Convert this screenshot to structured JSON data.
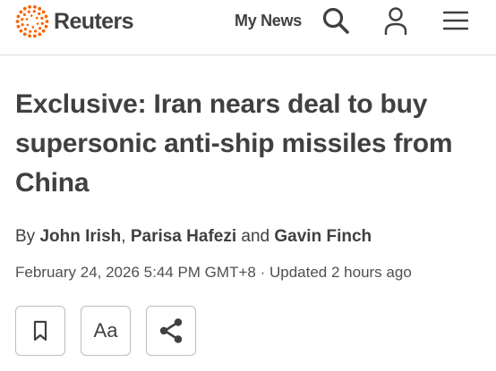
{
  "header": {
    "brand": "Reuters",
    "brand_color": "#fa6400",
    "my_news_label": "My News",
    "icons": [
      "search-icon",
      "account-icon",
      "menu-icon"
    ]
  },
  "article": {
    "headline": "Exclusive: Iran nears deal to buy supersonic anti-ship missiles from China",
    "byline": {
      "prefix": "By",
      "authors": [
        "John Irish",
        "Parisa Hafezi",
        "Gavin Finch"
      ],
      "separator": ",",
      "conjunction": "and"
    },
    "published": "February 24, 2026 5:44 PM GMT+8",
    "separator": "·",
    "updated": "Updated 2 hours ago"
  },
  "actions": {
    "bookmark_icon": "bookmark-icon",
    "text_size_label": "Aa",
    "share_icon": "share-icon"
  }
}
